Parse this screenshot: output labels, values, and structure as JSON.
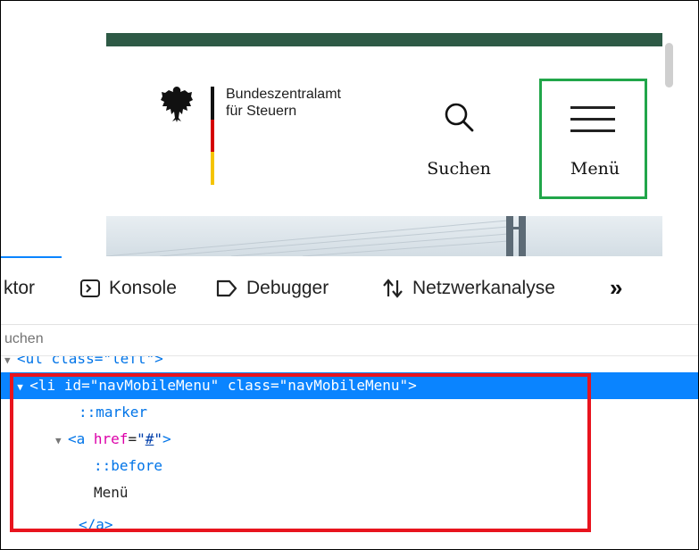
{
  "site": {
    "brand": "Bundeszentralamt\nfür Steuern",
    "search_label": "Suchen",
    "menu_label": "Menü",
    "colors": {
      "top_bar": "#2e5a46",
      "menu_highlight": "#21a64a"
    }
  },
  "devtools": {
    "tabs": [
      {
        "label": "ktor",
        "icon": ""
      },
      {
        "label": "Konsole",
        "icon": "console-icon"
      },
      {
        "label": "Debugger",
        "icon": "debugger-icon"
      },
      {
        "label": "Netzwerkanalyse",
        "icon": "network-icon"
      }
    ],
    "more_tabs": "»",
    "search_placeholder": "uchen",
    "tree": {
      "partial_line": "<ul class=\"left\">",
      "li": {
        "open": "<li",
        "id_attr": "id",
        "id_val": "\"navMobileMenu\"",
        "class_attr": "class",
        "class_val": "\"navMobileMenu\"",
        "close": ">"
      },
      "marker": "::marker",
      "a": {
        "open": "<a",
        "href_attr": "href",
        "href_val": "#"
      },
      "before": "::before",
      "text": "Menü",
      "a_close": "</a>"
    },
    "colors": {
      "selection": "#0a84ff",
      "highlight_box": "#e8141e"
    }
  }
}
